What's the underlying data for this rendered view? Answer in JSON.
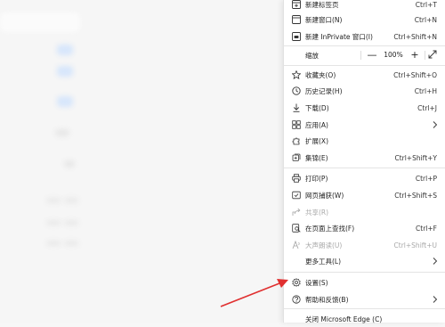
{
  "menu": {
    "new_tab": {
      "label": "新建标签页",
      "shortcut": "Ctrl+T"
    },
    "new_window": {
      "label": "新建窗口(N)",
      "shortcut": "Ctrl+N"
    },
    "new_inprivate": {
      "label": "新建 InPrivate 窗口(I)",
      "shortcut": "Ctrl+Shift+N"
    },
    "zoom": {
      "label": "缩放",
      "minus": "—",
      "value": "100%",
      "plus": "+"
    },
    "favorites": {
      "label": "收藏夹(O)",
      "shortcut": "Ctrl+Shift+O"
    },
    "history": {
      "label": "历史记录(H)",
      "shortcut": "Ctrl+H"
    },
    "downloads": {
      "label": "下载(D)",
      "shortcut": "Ctrl+J"
    },
    "apps": {
      "label": "应用(A)"
    },
    "extensions": {
      "label": "扩展(X)"
    },
    "collections": {
      "label": "集锦(E)",
      "shortcut": "Ctrl+Shift+Y"
    },
    "print": {
      "label": "打印(P)",
      "shortcut": "Ctrl+P"
    },
    "web_capture": {
      "label": "网页捕获(W)",
      "shortcut": "Ctrl+Shift+S"
    },
    "share": {
      "label": "共享(R)"
    },
    "find": {
      "label": "在页面上查找(F)",
      "shortcut": "Ctrl+F"
    },
    "read_aloud": {
      "label": "大声朗读(U)",
      "shortcut": "Ctrl+Shift+U"
    },
    "more_tools": {
      "label": "更多工具(L)"
    },
    "settings": {
      "label": "设置(S)"
    },
    "help": {
      "label": "帮助和反馈(B)"
    },
    "close": {
      "label": "关闭 Microsoft Edge (C)"
    }
  },
  "colors": {
    "arrow": "#e03030",
    "separator": "#e4e4e4",
    "disabled_text": "#a8a8a8"
  }
}
